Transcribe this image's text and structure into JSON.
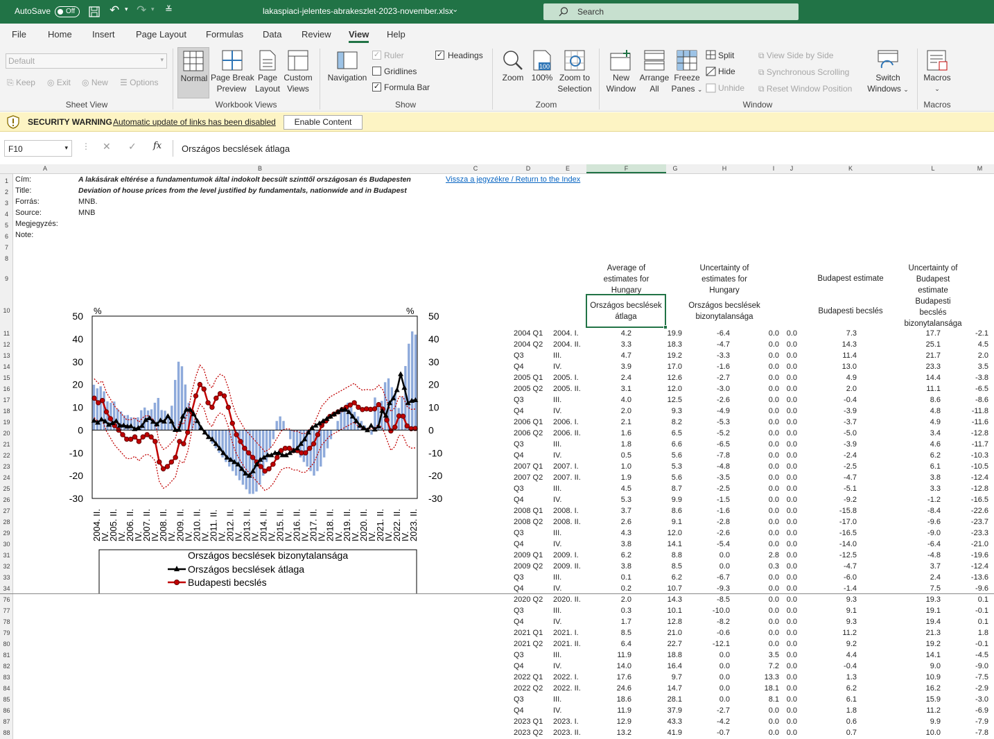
{
  "titlebar": {
    "autosave": "AutoSave",
    "toggle": "Off",
    "filename": "lakaspiaci-jelentes-abrakeszlet-2023-november.xlsx",
    "search": "Search"
  },
  "menu": [
    "File",
    "Home",
    "Insert",
    "Page Layout",
    "Formulas",
    "Data",
    "Review",
    "View",
    "Help"
  ],
  "ribbon": {
    "sheetview": {
      "dropdown": "Default",
      "keep": "Keep",
      "exit": "Exit",
      "new": "New",
      "options": "Options",
      "group": "Sheet View"
    },
    "workbookviews": {
      "normal": "Normal",
      "pagebreak": [
        "Page Break",
        "Preview"
      ],
      "pagelayout": [
        "Page",
        "Layout"
      ],
      "custom": [
        "Custom",
        "Views"
      ],
      "group": "Workbook Views"
    },
    "show": {
      "navigation": "Navigation",
      "ruler": "Ruler",
      "gridlines": "Gridlines",
      "formulabar": "Formula Bar",
      "headings": "Headings",
      "group": "Show"
    },
    "zoom": {
      "zoom": "Zoom",
      "z100": "100%",
      "zoomsel": [
        "Zoom to",
        "Selection"
      ],
      "group": "Zoom"
    },
    "window": {
      "newwin": [
        "New",
        "Window"
      ],
      "arrange": [
        "Arrange",
        "All"
      ],
      "freeze": [
        "Freeze",
        "Panes"
      ],
      "split": "Split",
      "hide": "Hide",
      "unhide": "Unhide",
      "sbs": "View Side by Side",
      "sync": "Synchronous Scrolling",
      "reset": "Reset Window Position",
      "switch": [
        "Switch",
        "Windows"
      ],
      "group": "Window"
    },
    "macros": {
      "macros": "Macros",
      "group": "Macros"
    }
  },
  "security": {
    "title": "SECURITY WARNING",
    "message": "Automatic update of links has been disabled",
    "button": "Enable Content"
  },
  "formulabar": {
    "namebox": "F10",
    "content": "Országos becslések átlaga"
  },
  "columns": [
    "A",
    "B",
    "C",
    "D",
    "E",
    "F",
    "G",
    "H",
    "I",
    "J",
    "K",
    "L",
    "M"
  ],
  "meta": {
    "cim_label": "Cím:",
    "cim": "A lakásárak eltérése a fundamentumok által indokolt becsült szinttől országosan és Budapesten",
    "title_label": "Title:",
    "title": "Deviation of house prices from the level justified by fundamentals, nationwide and in Budapest",
    "forras_label": "Forrás:",
    "forras": "MNB.",
    "source_label": "Source:",
    "source": "MNB",
    "megj_label": "Megjegyzés:",
    "note_label": "Note:",
    "link": "Vissza a jegyzékre / Return to the Index"
  },
  "headers": {
    "f_en": [
      "Average of",
      "estimates for",
      "Hungary"
    ],
    "f_hu": [
      "Országos becslések",
      "átlaga"
    ],
    "h_en": [
      "Uncertainty of",
      "estimates for",
      "Hungary"
    ],
    "h_hu": [
      "Országos becslések",
      "bizonytalansága"
    ],
    "k_en": "Budapest estimate",
    "k_hu": "Budapesti becslés",
    "l_en": [
      "Uncertainty of",
      "Budapest",
      "estimate"
    ],
    "l_hu": [
      "Budapesti",
      "becslés",
      "bizonytalansága"
    ]
  },
  "rows_top": [
    [
      "11",
      "2004 Q1",
      "2004. I.",
      "4.2",
      "19.9",
      "-6.4",
      "0.0",
      "0.0",
      "7.3",
      "17.7",
      "-2.1"
    ],
    [
      "12",
      "2004 Q2",
      "2004. II.",
      "3.3",
      "18.3",
      "-4.7",
      "0.0",
      "0.0",
      "14.3",
      "25.1",
      "4.5"
    ],
    [
      "13",
      "Q3",
      "III.",
      "4.7",
      "19.2",
      "-3.3",
      "0.0",
      "0.0",
      "11.4",
      "21.7",
      "2.0"
    ],
    [
      "14",
      "Q4",
      "IV.",
      "3.9",
      "17.0",
      "-1.6",
      "0.0",
      "0.0",
      "13.0",
      "23.3",
      "3.5"
    ],
    [
      "15",
      "2005 Q1",
      "2005. I.",
      "2.4",
      "12.6",
      "-2.7",
      "0.0",
      "0.0",
      "4.9",
      "14.4",
      "-3.8"
    ],
    [
      "16",
      "2005 Q2",
      "2005. II.",
      "3.1",
      "12.0",
      "-3.0",
      "0.0",
      "0.0",
      "2.0",
      "11.1",
      "-6.5"
    ],
    [
      "17",
      "Q3",
      "III.",
      "4.0",
      "12.5",
      "-2.6",
      "0.0",
      "0.0",
      "-0.4",
      "8.6",
      "-8.6"
    ],
    [
      "18",
      "Q4",
      "IV.",
      "2.0",
      "9.3",
      "-4.9",
      "0.0",
      "0.0",
      "-3.9",
      "4.8",
      "-11.8"
    ],
    [
      "19",
      "2006 Q1",
      "2006. I.",
      "2.1",
      "8.2",
      "-5.3",
      "0.0",
      "0.0",
      "-3.7",
      "4.9",
      "-11.6"
    ],
    [
      "20",
      "2006 Q2",
      "2006. II.",
      "1.6",
      "6.5",
      "-5.2",
      "0.0",
      "0.0",
      "-5.0",
      "3.4",
      "-12.8"
    ],
    [
      "21",
      "Q3",
      "III.",
      "1.8",
      "6.6",
      "-6.5",
      "0.0",
      "0.0",
      "-3.9",
      "4.6",
      "-11.7"
    ],
    [
      "22",
      "Q4",
      "IV.",
      "0.5",
      "5.6",
      "-7.8",
      "0.0",
      "0.0",
      "-2.4",
      "6.2",
      "-10.3"
    ],
    [
      "23",
      "2007 Q1",
      "2007. I.",
      "1.0",
      "5.3",
      "-4.8",
      "0.0",
      "0.0",
      "-2.5",
      "6.1",
      "-10.5"
    ],
    [
      "24",
      "2007 Q2",
      "2007. II.",
      "1.9",
      "5.6",
      "-3.5",
      "0.0",
      "0.0",
      "-4.7",
      "3.8",
      "-12.4"
    ],
    [
      "25",
      "Q3",
      "III.",
      "4.5",
      "8.7",
      "-2.5",
      "0.0",
      "0.0",
      "-5.1",
      "3.3",
      "-12.8"
    ],
    [
      "26",
      "Q4",
      "IV.",
      "5.3",
      "9.9",
      "-1.5",
      "0.0",
      "0.0",
      "-9.2",
      "-1.2",
      "-16.5"
    ],
    [
      "27",
      "2008 Q1",
      "2008. I.",
      "3.7",
      "8.6",
      "-1.6",
      "0.0",
      "0.0",
      "-15.8",
      "-8.4",
      "-22.6"
    ],
    [
      "28",
      "2008 Q2",
      "2008. II.",
      "2.6",
      "9.1",
      "-2.8",
      "0.0",
      "0.0",
      "-17.0",
      "-9.6",
      "-23.7"
    ],
    [
      "29",
      "Q3",
      "III.",
      "4.3",
      "12.0",
      "-2.6",
      "0.0",
      "0.0",
      "-16.5",
      "-9.0",
      "-23.3"
    ],
    [
      "30",
      "Q4",
      "IV.",
      "3.8",
      "14.1",
      "-5.4",
      "0.0",
      "0.0",
      "-14.0",
      "-6.4",
      "-21.0"
    ],
    [
      "31",
      "2009 Q1",
      "2009. I.",
      "6.2",
      "8.8",
      "0.0",
      "2.8",
      "0.0",
      "-12.5",
      "-4.8",
      "-19.6"
    ],
    [
      "32",
      "2009 Q2",
      "2009. II.",
      "3.8",
      "8.5",
      "0.0",
      "0.3",
      "0.0",
      "-4.7",
      "3.7",
      "-12.4"
    ],
    [
      "33",
      "Q3",
      "III.",
      "0.1",
      "6.2",
      "-6.7",
      "0.0",
      "0.0",
      "-6.0",
      "2.4",
      "-13.6"
    ],
    [
      "34",
      "Q4",
      "IV.",
      "0.2",
      "10.7",
      "-9.3",
      "0.0",
      "0.0",
      "-1.4",
      "7.5",
      "-9.6"
    ]
  ],
  "rows_bottom": [
    [
      "76",
      "2020 Q2",
      "2020. II.",
      "2.0",
      "14.3",
      "-8.5",
      "0.0",
      "0.0",
      "9.3",
      "19.3",
      "0.1"
    ],
    [
      "77",
      "Q3",
      "III.",
      "0.3",
      "10.1",
      "-10.0",
      "0.0",
      "0.0",
      "9.1",
      "19.1",
      "-0.1"
    ],
    [
      "78",
      "Q4",
      "IV.",
      "1.7",
      "12.8",
      "-8.2",
      "0.0",
      "0.0",
      "9.3",
      "19.4",
      "0.1"
    ],
    [
      "79",
      "2021 Q1",
      "2021. I.",
      "8.5",
      "21.0",
      "-0.6",
      "0.0",
      "0.0",
      "11.2",
      "21.3",
      "1.8"
    ],
    [
      "80",
      "2021 Q2",
      "2021. II.",
      "6.4",
      "22.7",
      "-12.1",
      "0.0",
      "0.0",
      "9.2",
      "19.2",
      "-0.1"
    ],
    [
      "81",
      "Q3",
      "III.",
      "11.9",
      "18.8",
      "0.0",
      "3.5",
      "0.0",
      "4.4",
      "14.1",
      "-4.5"
    ],
    [
      "82",
      "Q4",
      "IV.",
      "14.0",
      "16.4",
      "0.0",
      "7.2",
      "0.0",
      "-0.4",
      "9.0",
      "-9.0"
    ],
    [
      "83",
      "2022 Q1",
      "2022. I.",
      "17.6",
      "9.7",
      "0.0",
      "13.3",
      "0.0",
      "1.3",
      "10.9",
      "-7.5"
    ],
    [
      "84",
      "2022 Q2",
      "2022. II.",
      "24.6",
      "14.7",
      "0.0",
      "18.1",
      "0.0",
      "6.2",
      "16.2",
      "-2.9"
    ],
    [
      "85",
      "Q3",
      "III.",
      "18.6",
      "28.1",
      "0.0",
      "8.1",
      "0.0",
      "6.1",
      "15.9",
      "-3.0"
    ],
    [
      "86",
      "Q4",
      "IV.",
      "11.9",
      "37.9",
      "-2.7",
      "0.0",
      "0.0",
      "1.8",
      "11.2",
      "-6.9"
    ],
    [
      "87",
      "2023 Q1",
      "2023. I.",
      "12.9",
      "43.3",
      "-4.2",
      "0.0",
      "0.0",
      "0.6",
      "9.9",
      "-7.9"
    ],
    [
      "88",
      "2023 Q2",
      "2023. II.",
      "13.2",
      "41.9",
      "-0.7",
      "0.0",
      "0.0",
      "0.7",
      "10.0",
      "-7.8"
    ]
  ],
  "chart_data": {
    "type": "line",
    "ylim": [
      -30,
      50
    ],
    "yticks": [
      "50",
      "40",
      "30",
      "20",
      "10",
      "0",
      "-10",
      "-20",
      "-30"
    ],
    "unit_left": "%",
    "unit_right": "%",
    "x_labels": [
      "2004. II.",
      "IV.",
      "2005. II.",
      "IV.",
      "2006. II.",
      "IV.",
      "2007. II.",
      "IV.",
      "2008. II.",
      "IV.",
      "2009. II.",
      "IV.",
      "2010. II.",
      "IV.",
      "2011. II.",
      "IV.",
      "2012. II.",
      "IV.",
      "2013. II.",
      "IV.",
      "2014. II.",
      "IV.",
      "2015. II.",
      "IV.",
      "2016. II.",
      "IV.",
      "2017. II.",
      "IV.",
      "2018. II.",
      "IV.",
      "2019. II.",
      "IV.",
      "2020. II.",
      "IV.",
      "2021. II.",
      "IV.",
      "2022. II.",
      "IV.",
      "2023. II."
    ],
    "series": [
      {
        "name": "Országos becslések bizonytalansága",
        "kind": "bar",
        "color": "#8eaadb",
        "values": [
          19.9,
          18.3,
          19.2,
          17,
          12.6,
          12,
          12.5,
          9.3,
          8.2,
          6.5,
          6.6,
          5.6,
          5.3,
          5.6,
          8.7,
          9.9,
          8.6,
          9.1,
          12,
          14.1,
          8.8,
          8.5,
          6.2,
          10.7,
          22,
          30,
          28,
          20,
          12,
          8,
          5,
          3,
          0,
          -2,
          -4,
          -6,
          -8,
          -10,
          -12,
          -14,
          -16,
          -18,
          -20,
          -22,
          -24,
          -26,
          -28,
          -28,
          -27,
          -24,
          -20,
          -14,
          -8,
          -4,
          4,
          6,
          4,
          0,
          -4,
          -8,
          -10,
          -12,
          -14,
          -16,
          -18,
          -20,
          -18,
          -16,
          -12,
          -8,
          -4,
          0,
          4,
          8,
          10,
          12,
          10,
          8,
          6,
          4,
          2,
          0,
          -2,
          14.3,
          10.1,
          12.8,
          21,
          22.7,
          18.8,
          16.4,
          9.7,
          14.7,
          28.1,
          37.9,
          43.3,
          41.9
        ]
      },
      {
        "name": "Országos becslések átlaga",
        "kind": "line",
        "color": "#000000",
        "marker": "triangle",
        "values": [
          4.2,
          3.3,
          4.7,
          3.9,
          2.4,
          3.1,
          4,
          2,
          2.1,
          1.6,
          1.8,
          0.5,
          1,
          1.9,
          4.5,
          5.3,
          3.7,
          2.6,
          4.3,
          3.8,
          6.2,
          3.8,
          0.1,
          0.2,
          6,
          9,
          9,
          7,
          4,
          1,
          -1,
          -3,
          -4,
          -6,
          -8,
          -10,
          -12,
          -13,
          -14,
          -15,
          -17,
          -19,
          -20,
          -18,
          -15,
          -13,
          -12,
          -11,
          -11,
          -10,
          -10,
          -11,
          -11,
          -10,
          -9,
          -8,
          -6,
          -4,
          -1,
          1,
          2,
          3,
          4,
          5,
          6,
          7,
          8,
          9,
          9,
          8,
          6,
          4,
          2,
          1,
          0,
          2.0,
          0.3,
          1.7,
          8.5,
          6.4,
          11.9,
          14,
          17.6,
          24.6,
          18.6,
          11.9,
          12.9,
          13.2
        ]
      },
      {
        "name": "Budapesti becslés",
        "kind": "line",
        "color": "#c00000",
        "marker": "circle",
        "values": [
          14,
          12,
          13,
          8,
          5,
          2,
          0,
          -2,
          -4,
          -4,
          -3,
          -5,
          -3,
          -2,
          -3,
          -5,
          -14,
          -17,
          -16,
          -14,
          -12,
          -5,
          -6,
          -1,
          8,
          15,
          20,
          18,
          12,
          10,
          14,
          16,
          15,
          10,
          3,
          -2,
          -5,
          -8,
          -10,
          -12,
          -14,
          -16,
          -18,
          -17,
          -15,
          -12,
          -9,
          -8,
          -8,
          -9,
          -9,
          -10,
          -10,
          -8,
          -6,
          -2,
          2,
          4,
          6,
          7,
          8,
          9,
          10,
          11,
          12,
          10,
          9,
          9.3,
          9.1,
          9.3,
          11.2,
          9.2,
          4.4,
          -0.4,
          1.3,
          6.2,
          6.1,
          1.8,
          0.6,
          0.7
        ]
      }
    ],
    "legend": [
      "Országos becslések bizonytalansága",
      "Országos becslések átlaga",
      "Budapesti becslés"
    ]
  }
}
